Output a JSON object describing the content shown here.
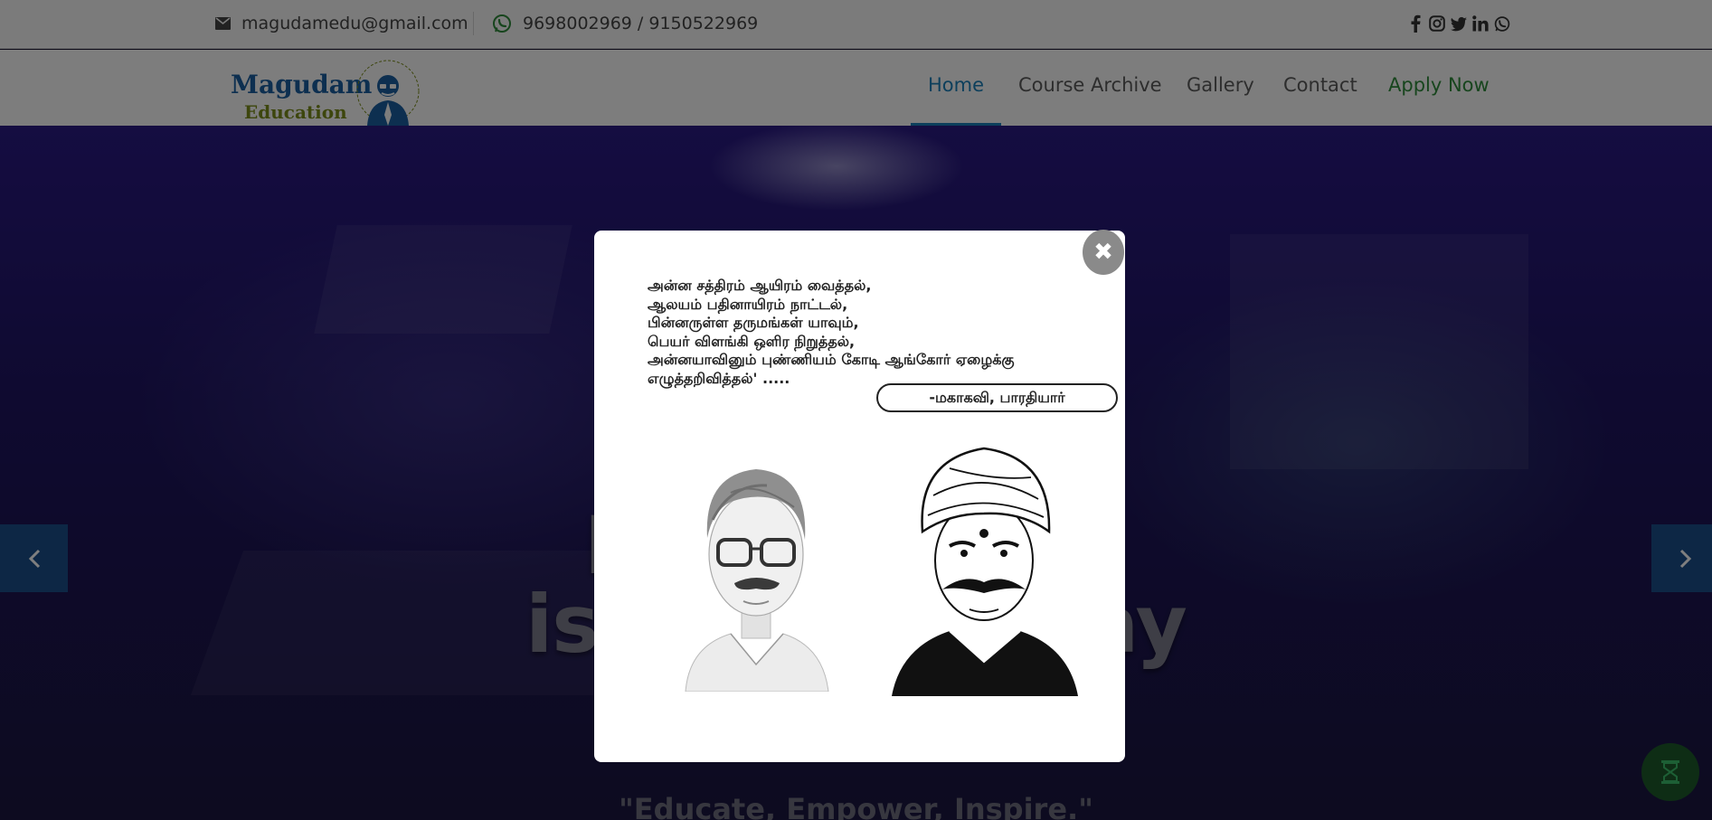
{
  "topbar": {
    "email": "magudamedu@gmail.com",
    "phone": "9698002969 / 9150522969",
    "social_icons": [
      "facebook-icon",
      "instagram-icon",
      "twitter-icon",
      "linkedin-icon",
      "whatsapp-icon"
    ]
  },
  "logo": {
    "line1": "Magudam",
    "line2": "Education"
  },
  "nav": {
    "home": "Home",
    "course_archive": "Course Archive",
    "gallery": "Gallery",
    "contact": "Contact",
    "apply_now": "Apply Now"
  },
  "hero": {
    "headline_line1": "Innov          cation",
    "headline_line2": "isn't an           ne way",
    "tagline": "\"Educate, Empower, Inspire.\""
  },
  "modal": {
    "close_symbol": "✖",
    "poem_lines": [
      "அன்ன சத்திரம் ஆயிரம் வைத்தல்,",
      "ஆலயம் பதினாயிரம் நாட்டல்,",
      "பின்னருள்ள தருமங்கள் யாவும்,",
      "பெயர் விளங்கி ஒளிர நிறுத்தல்,",
      "அன்னயாவினும் புண்ணியம் கோடி ஆங்கோர் ஏழைக்கு",
      "எழுத்தறிவித்தல்' ....."
    ],
    "attribution": "-மகாகவி, பாரதியார்"
  },
  "colors": {
    "primary_blue": "#1a7fb8",
    "apply_green": "#2e8b3a",
    "arrow_blue": "#1b4f8a",
    "fab_green": "#1d5a2b"
  }
}
